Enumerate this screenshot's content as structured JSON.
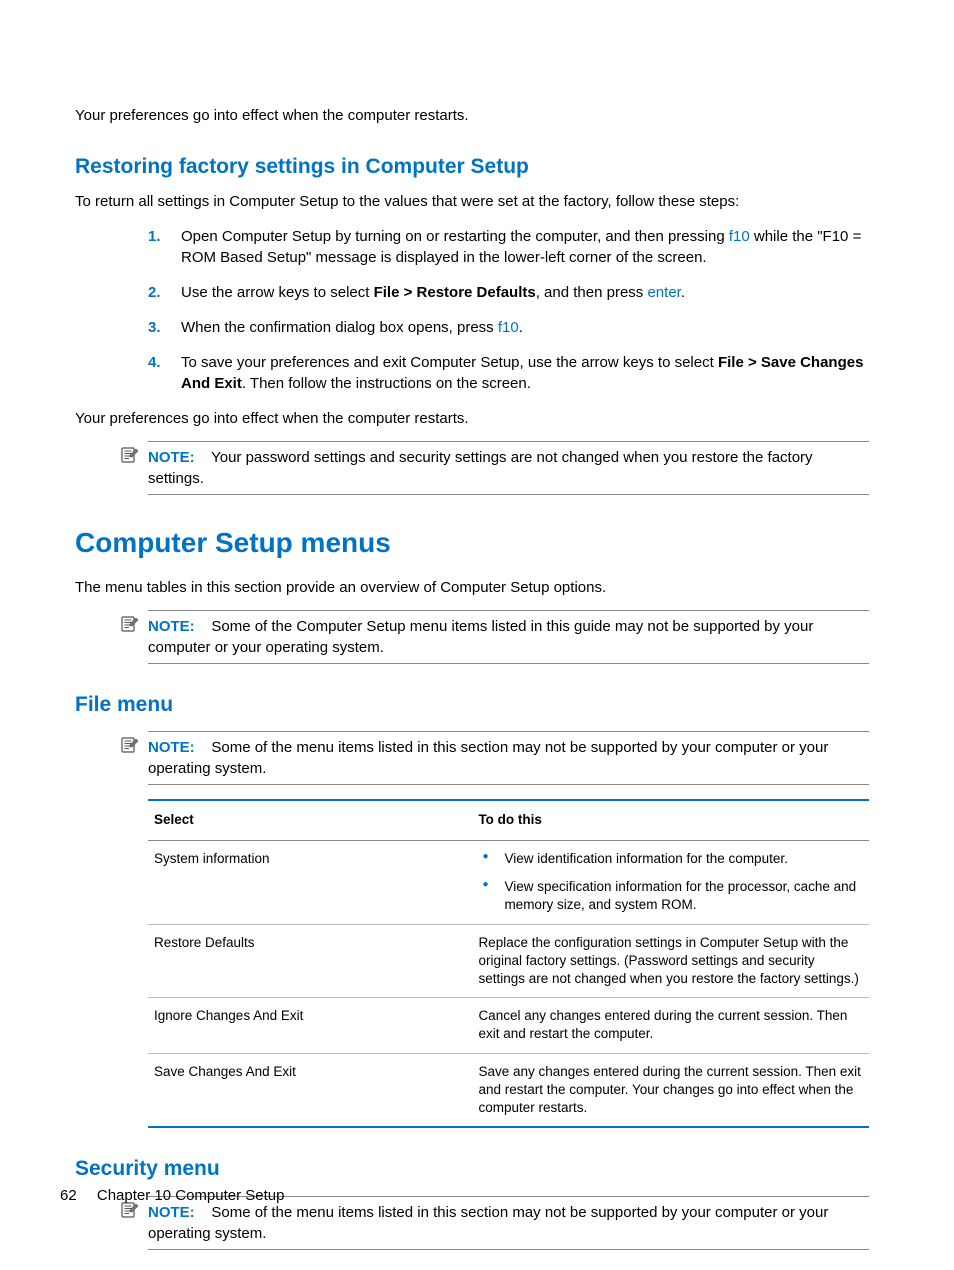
{
  "intro_para": "Your preferences go into effect when the computer restarts.",
  "h_restoring": "Restoring factory settings in Computer Setup",
  "p_restoring_intro": "To return all settings in Computer Setup to the values that were set at the factory, follow these steps:",
  "steps": {
    "s1": {
      "num": "1.",
      "a": "Open Computer Setup by turning on or restarting the computer, and then pressing ",
      "key": "f10",
      "b": " while the \"F10 = ROM Based Setup\" message is displayed in the lower-left corner of the screen."
    },
    "s2": {
      "num": "2.",
      "a": "Use the arrow keys to select ",
      "bold": "File > Restore Defaults",
      "b": ", and then press ",
      "key": "enter",
      "c": "."
    },
    "s3": {
      "num": "3.",
      "a": "When the confirmation dialog box opens, press ",
      "key": "f10",
      "b": "."
    },
    "s4": {
      "num": "4.",
      "a": "To save your preferences and exit Computer Setup, use the arrow keys to select ",
      "bold": "File > Save Changes And Exit",
      "b": ". Then follow the instructions on the screen."
    }
  },
  "p_restoring_outro": "Your preferences go into effect when the computer restarts.",
  "note1": {
    "label": "NOTE:",
    "text": "Your password settings and security settings are not changed when you restore the factory settings."
  },
  "h_menus": "Computer Setup menus",
  "p_menus_intro": "The menu tables in this section provide an overview of Computer Setup options.",
  "note2": {
    "label": "NOTE:",
    "text": "Some of the Computer Setup menu items listed in this guide may not be supported by your computer or your operating system."
  },
  "h_file": "File menu",
  "note3": {
    "label": "NOTE:",
    "text": "Some of the menu items listed in this section may not be supported by your computer or your operating system."
  },
  "table": {
    "th1": "Select",
    "th2": "To do this",
    "rows": [
      {
        "select": "System information",
        "type": "list",
        "items": [
          "View identification information for the computer.",
          "View specification information for the processor, cache and memory size, and system ROM."
        ]
      },
      {
        "select": "Restore Defaults",
        "type": "text",
        "text": "Replace the configuration settings in Computer Setup with the original factory settings. (Password settings and security settings are not changed when you restore the factory settings.)"
      },
      {
        "select": "Ignore Changes And Exit",
        "type": "text",
        "text": "Cancel any changes entered during the current session. Then exit and restart the computer."
      },
      {
        "select": "Save Changes And Exit",
        "type": "text",
        "text": "Save any changes entered during the current session. Then exit and restart the computer. Your changes go into effect when the computer restarts."
      }
    ]
  },
  "h_security": "Security menu",
  "note4": {
    "label": "NOTE:",
    "text": "Some of the menu items listed in this section may not be supported by your computer or your operating system."
  },
  "footer": {
    "page": "62",
    "chapter": "Chapter 10   Computer Setup"
  }
}
